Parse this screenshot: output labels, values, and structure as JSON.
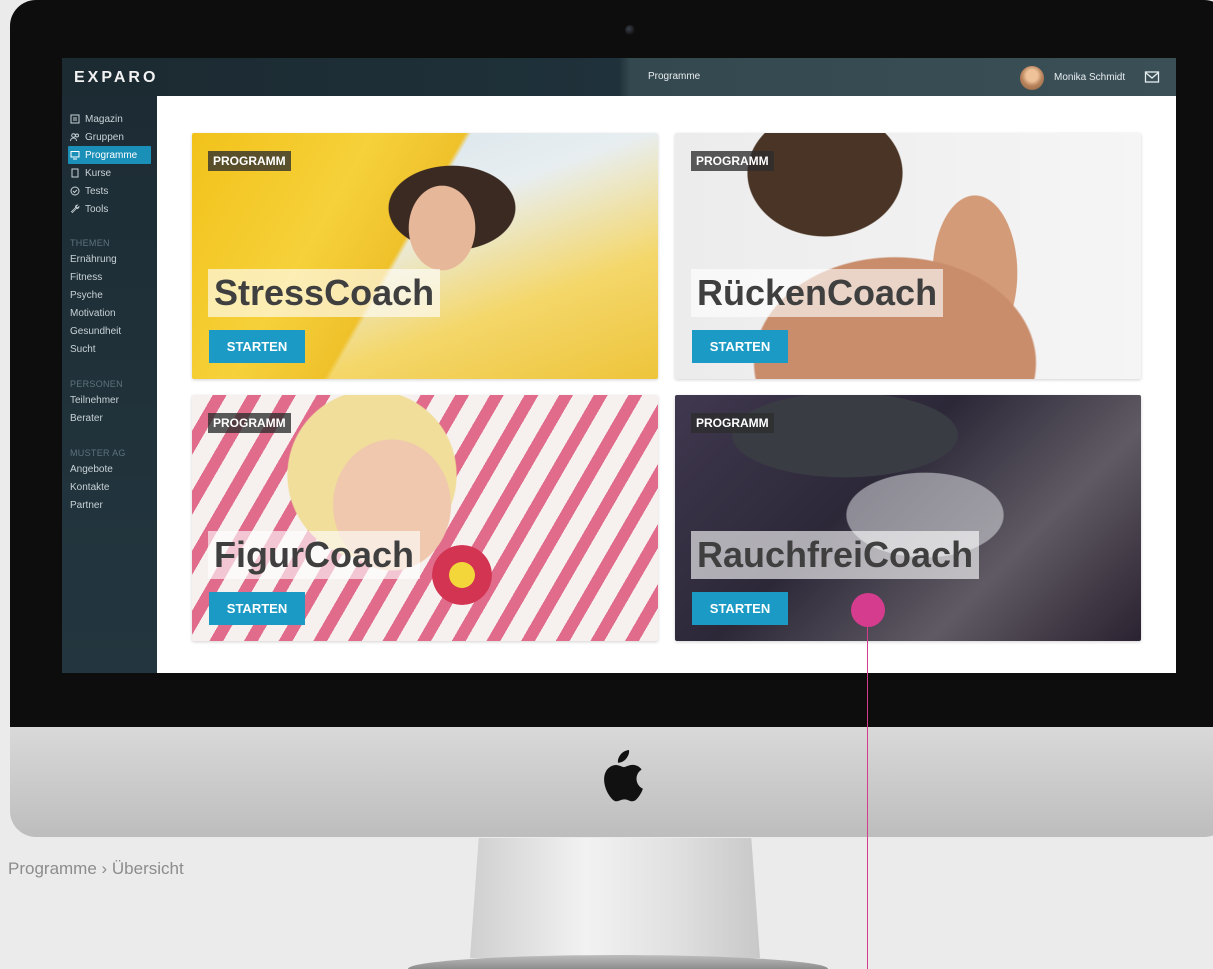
{
  "app": {
    "brand": "EXPARO",
    "page_title": "Programme"
  },
  "user": {
    "name": "Monika Schmidt"
  },
  "sidebar": {
    "main_items": [
      {
        "label": "Magazin",
        "icon": "newspaper-icon"
      },
      {
        "label": "Gruppen",
        "icon": "group-icon"
      },
      {
        "label": "Programme",
        "icon": "monitor-icon",
        "active": true
      },
      {
        "label": "Kurse",
        "icon": "book-icon"
      },
      {
        "label": "Tests",
        "icon": "check-circle-icon"
      },
      {
        "label": "Tools",
        "icon": "wrench-icon"
      }
    ],
    "sections": [
      {
        "title": "THEMEN",
        "items": [
          "Ernährung",
          "Fitness",
          "Psyche",
          "Motivation",
          "Gesundheit",
          "Sucht"
        ]
      },
      {
        "title": "PERSONEN",
        "items": [
          "Teilnehmer",
          "Berater"
        ]
      },
      {
        "title": "MUSTER AG",
        "items": [
          "Angebote",
          "Kontakte",
          "Partner"
        ]
      }
    ]
  },
  "programs": [
    {
      "tag": "PROGRAMM",
      "title": "StressCoach",
      "button": "STARTEN"
    },
    {
      "tag": "PROGRAMM",
      "title": "RückenCoach",
      "button": "STARTEN"
    },
    {
      "tag": "PROGRAMM",
      "title": "FigurCoach",
      "button": "STARTEN"
    },
    {
      "tag": "PROGRAMM",
      "title": "RauchfreiCoach",
      "button": "STARTEN"
    }
  ],
  "caption": "Programme › Übersicht",
  "colors": {
    "accent": "#1a9ac5",
    "sidebar_bg": "#1d2c34",
    "callout": "#d63c8e"
  }
}
